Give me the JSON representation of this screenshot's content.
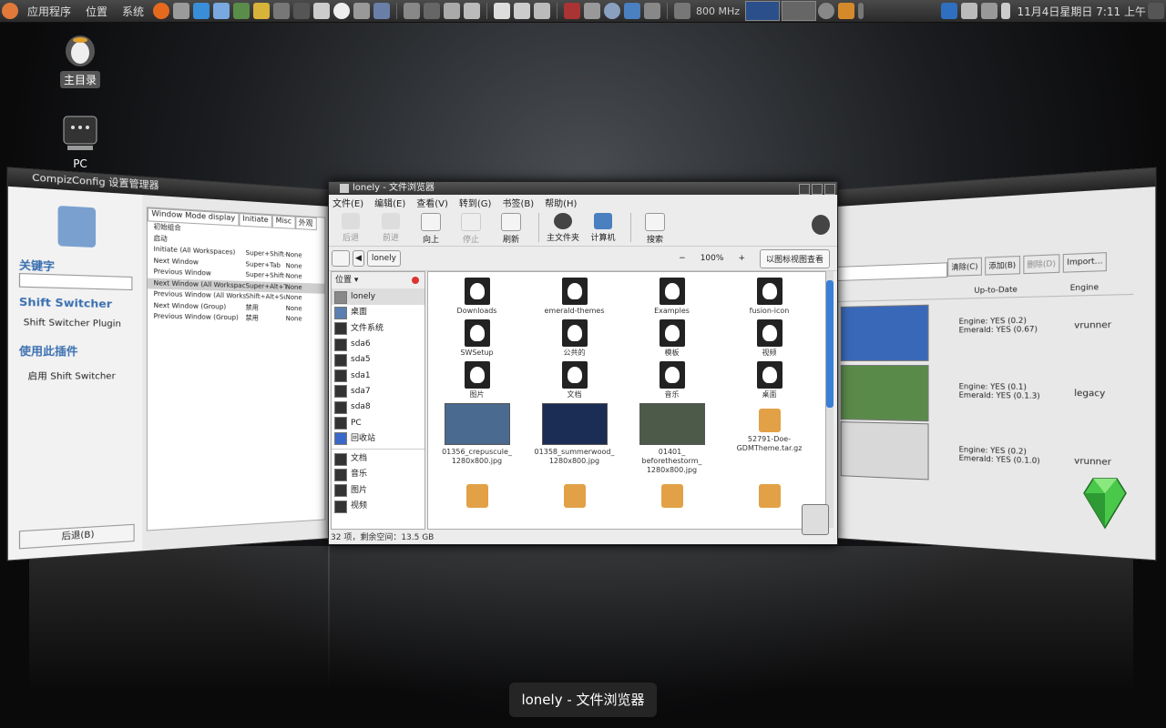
{
  "panel": {
    "menus": [
      "应用程序",
      "位置",
      "系统"
    ],
    "cpu_freq": "800 MHz",
    "clock": "11月4日星期日  7:11 上午"
  },
  "desktop": {
    "icons": [
      {
        "label": "主目录",
        "icon": "home-penguin-icon"
      },
      {
        "label": "PC",
        "icon": "network-icon"
      }
    ]
  },
  "left_window": {
    "title": "CompizConfig 设置管理器",
    "sidebar_labels": [
      "关键字",
      "Shift Switcher",
      "Shift Switcher Plugin",
      "使用此插件",
      "启用 Shift Switcher"
    ],
    "back_button": "后退(B)",
    "tabs": [
      "Window Mode display",
      "Initiate",
      "Misc",
      "外观"
    ],
    "rows": [
      {
        "name": "初始组合",
        "binding": "",
        "state": ""
      },
      {
        "name": "启动",
        "binding": "",
        "state": ""
      },
      {
        "name": "Initiate (All Workspaces)",
        "binding": "Super+Shift+s",
        "state": "None"
      },
      {
        "name": "Next Window",
        "binding": "Super+Tab",
        "state": "None"
      },
      {
        "name": "Previous Window",
        "binding": "Super+Shift+Tab",
        "state": "None"
      },
      {
        "name": "Next Window (All Workspaces)",
        "binding": "Super+Alt+Tab",
        "state": "None"
      },
      {
        "name": "Previous Window (All Workspaces)",
        "binding": "Shift+Alt+Super+Tab",
        "state": "None"
      },
      {
        "name": "Next Window (Group)",
        "binding": "禁用",
        "state": "None"
      },
      {
        "name": "Previous Window (Group)",
        "binding": "禁用",
        "state": "None"
      }
    ]
  },
  "right_window": {
    "buttons": [
      "清除(C)",
      "添加(B)",
      "删除(D)",
      "Import..."
    ],
    "columns": [
      "Up-to-Date",
      "Engine"
    ],
    "rows": [
      {
        "status": "Engine: YES (0.2)\nEmerald: YES (0.67)",
        "engine": "vrunner"
      },
      {
        "status": "Engine: YES (0.1)\nEmerald: YES (0.1.3)",
        "engine": "legacy"
      },
      {
        "status": "Engine: YES (0.2)\nEmerald: YES (0.1.0)",
        "engine": "vrunner"
      }
    ]
  },
  "file_browser": {
    "title": "lonely - 文件浏览器",
    "menu": [
      "文件(E)",
      "编辑(E)",
      "查看(V)",
      "转到(G)",
      "书签(B)",
      "帮助(H)"
    ],
    "toolbar": [
      {
        "label": "后退",
        "icon": "back-arrow-icon",
        "disabled": true
      },
      {
        "label": "前进",
        "icon": "forward-arrow-icon",
        "disabled": true
      },
      {
        "label": "向上",
        "icon": "up-arrow-icon",
        "disabled": false
      },
      {
        "label": "停止",
        "icon": "stop-icon",
        "disabled": true
      },
      {
        "label": "刷新",
        "icon": "refresh-icon",
        "disabled": false
      },
      {
        "label": "主文件夹",
        "icon": "home-folder-icon",
        "disabled": false
      },
      {
        "label": "计算机",
        "icon": "computer-icon",
        "disabled": false
      },
      {
        "label": "搜索",
        "icon": "search-icon",
        "disabled": false
      }
    ],
    "location": "lonely",
    "zoom": "100%",
    "view_mode": "以图标视图查看",
    "sidebar_header": "位置",
    "places": [
      "lonely",
      "桌面",
      "文件系统",
      "sda6",
      "sda5",
      "sda1",
      "sda7",
      "sda8",
      "PC",
      "回收站"
    ],
    "bookmarks": [
      "文档",
      "音乐",
      "图片",
      "视频"
    ],
    "items": [
      {
        "name": "Downloads",
        "kind": "folder"
      },
      {
        "name": "emerald-themes",
        "kind": "folder"
      },
      {
        "name": "Examples",
        "kind": "folder"
      },
      {
        "name": "fusion-icon",
        "kind": "folder"
      },
      {
        "name": "SWSetup",
        "kind": "folder"
      },
      {
        "name": "公共的",
        "kind": "folder"
      },
      {
        "name": "模板",
        "kind": "folder"
      },
      {
        "name": "视频",
        "kind": "folder"
      },
      {
        "name": "图片",
        "kind": "folder"
      },
      {
        "name": "文档",
        "kind": "folder"
      },
      {
        "name": "音乐",
        "kind": "folder"
      },
      {
        "name": "桌面",
        "kind": "folder"
      },
      {
        "name": "01356_crepuscule_\n1280x800.jpg",
        "kind": "image",
        "color": "#4a6a90"
      },
      {
        "name": "01358_summerwood_\n1280x800.jpg",
        "kind": "image",
        "color": "#1b2d55"
      },
      {
        "name": "01401_\nbeforethestorm_\n1280x800.jpg",
        "kind": "image",
        "color": "#4d5a4a"
      },
      {
        "name": "52791-Doe-\nGDMTheme.tar.gz",
        "kind": "archive"
      },
      {
        "name": "",
        "kind": "archive"
      },
      {
        "name": "",
        "kind": "archive"
      },
      {
        "name": "",
        "kind": "archive"
      },
      {
        "name": "",
        "kind": "archive"
      }
    ],
    "status": "32 项，剩余空间：13.5 GB"
  },
  "switcher_label": "lonely - 文件浏览器",
  "colors": {
    "accent_blue": "#3a7fd6",
    "label_blue": "#3a6fb0",
    "emerald": "#4fd14a"
  }
}
